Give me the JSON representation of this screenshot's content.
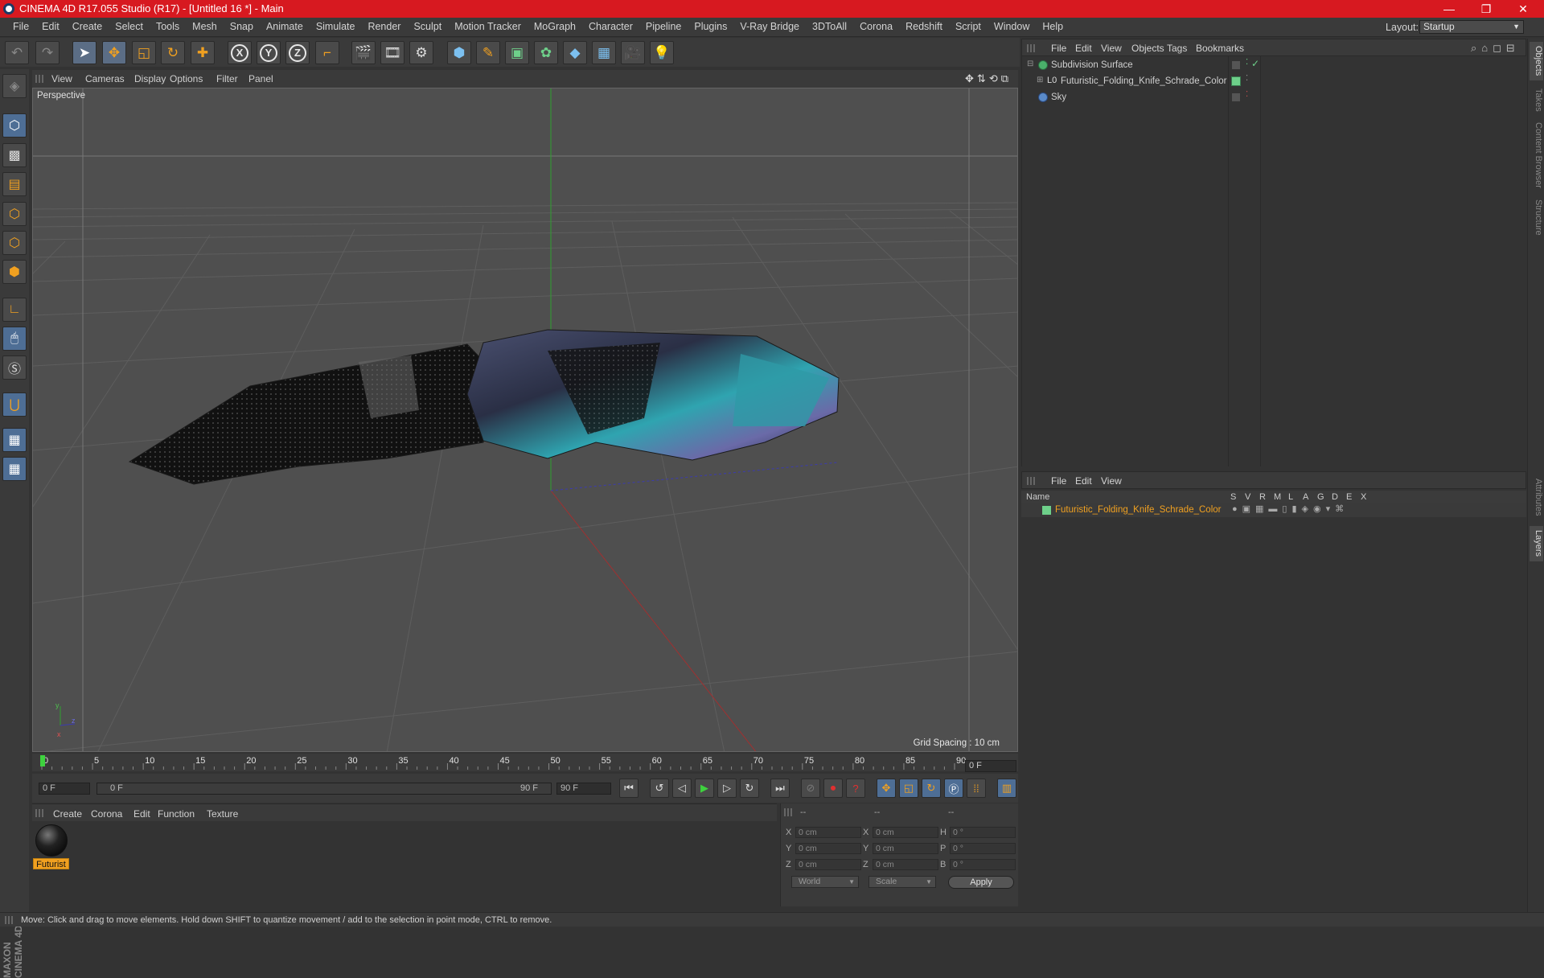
{
  "window": {
    "title": "CINEMA 4D R17.055 Studio (R17) - [Untitled 16 *] - Main",
    "minimize": "—",
    "restore": "❐",
    "close": "✕"
  },
  "menu": {
    "items": [
      "File",
      "Edit",
      "Create",
      "Select",
      "Tools",
      "Mesh",
      "Snap",
      "Animate",
      "Simulate",
      "Render",
      "Sculpt",
      "Motion Tracker",
      "MoGraph",
      "Character",
      "Pipeline",
      "Plugins",
      "V-Ray Bridge",
      "3DToAll",
      "Corona",
      "Redshift",
      "Script",
      "Window",
      "Help"
    ],
    "layout_label": "Layout:",
    "layout_value": "Startup"
  },
  "viewport": {
    "menu": [
      "View",
      "Cameras",
      "Display",
      "Options",
      "Filter",
      "Panel"
    ],
    "label": "Perspective",
    "grid_spacing": "Grid Spacing : 10 cm"
  },
  "timeline": {
    "ticks": [
      "0",
      "5",
      "10",
      "15",
      "20",
      "25",
      "30",
      "35",
      "40",
      "45",
      "50",
      "55",
      "60",
      "65",
      "70",
      "75",
      "80",
      "85",
      "90"
    ],
    "current_frame": "0 F",
    "start_field": "0 F",
    "range_start": "0 F",
    "range_end": "90 F",
    "end_field": "90 F"
  },
  "material_manager": {
    "menu": [
      "Create",
      "Corona",
      "Edit",
      "Function",
      "Texture"
    ],
    "material_name": "Futurist"
  },
  "coordinates": {
    "header": [
      "--",
      "--",
      "--"
    ],
    "rows": [
      {
        "a": "X",
        "v1": "0 cm",
        "b": "X",
        "v2": "0 cm",
        "c": "H",
        "v3": "0 °"
      },
      {
        "a": "Y",
        "v1": "0 cm",
        "b": "Y",
        "v2": "0 cm",
        "c": "P",
        "v3": "0 °"
      },
      {
        "a": "Z",
        "v1": "0 cm",
        "b": "Z",
        "v2": "0 cm",
        "c": "B",
        "v3": "0 °"
      }
    ],
    "mode": "World",
    "scale": "Scale",
    "apply": "Apply"
  },
  "object_manager": {
    "menu": [
      "File",
      "Edit",
      "View",
      "Objects",
      "Tags",
      "Bookmarks"
    ],
    "objects": [
      {
        "name": "Subdivision Surface"
      },
      {
        "name": "Futuristic_Folding_Knife_Schrade_Color"
      },
      {
        "name": "Sky"
      }
    ]
  },
  "layer_manager": {
    "menu": [
      "File",
      "Edit",
      "View"
    ],
    "columns": [
      "Name",
      "S",
      "V",
      "R",
      "M",
      "L",
      "A",
      "G",
      "D",
      "E",
      "X"
    ],
    "layer_name": "Futuristic_Folding_Knife_Schrade_Color"
  },
  "right_tabs": [
    "Objects",
    "Takes",
    "Content Browser",
    "Structure",
    "Attributes",
    "Layers"
  ],
  "status": "Move: Click and drag to move elements. Hold down SHIFT to quantize movement / add to the selection in point mode, CTRL to remove.",
  "colors": {
    "title_bar": "#d71920",
    "accent": "#f0a020",
    "layer_color": "#6ed08a"
  }
}
